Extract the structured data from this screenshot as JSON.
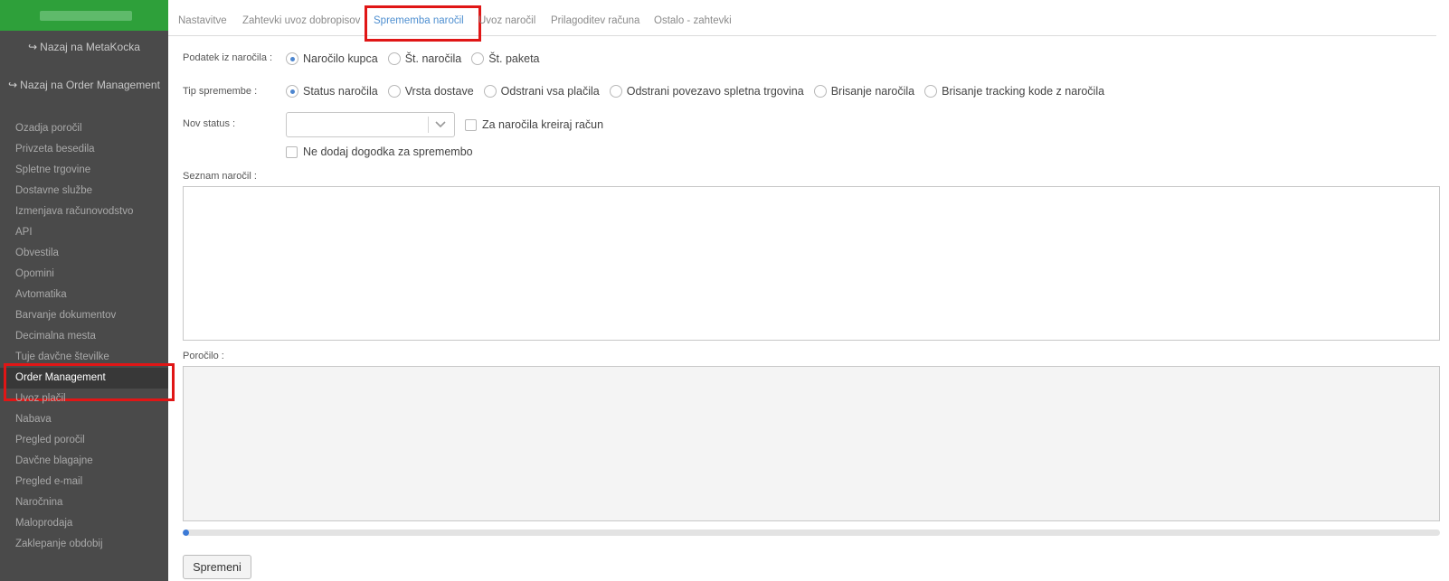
{
  "sidebar": {
    "back_metakocka": "Nazaj na MetaKocka",
    "back_order_management": "Nazaj na Order Management",
    "items": [
      {
        "label": "Ozadja poročil",
        "active": false
      },
      {
        "label": "Privzeta besedila",
        "active": false
      },
      {
        "label": "Spletne trgovine",
        "active": false
      },
      {
        "label": "Dostavne službe",
        "active": false
      },
      {
        "label": "Izmenjava računovodstvo",
        "active": false
      },
      {
        "label": "API",
        "active": false
      },
      {
        "label": "Obvestila",
        "active": false
      },
      {
        "label": "Opomini",
        "active": false
      },
      {
        "label": "Avtomatika",
        "active": false
      },
      {
        "label": "Barvanje dokumentov",
        "active": false
      },
      {
        "label": "Decimalna mesta",
        "active": false
      },
      {
        "label": "Tuje davčne številke",
        "active": false
      },
      {
        "label": "Order Management",
        "active": true
      },
      {
        "label": "Uvoz plačil",
        "active": false
      },
      {
        "label": "Nabava",
        "active": false
      },
      {
        "label": "Pregled poročil",
        "active": false
      },
      {
        "label": "Davčne blagajne",
        "active": false
      },
      {
        "label": "Pregled e-mail",
        "active": false
      },
      {
        "label": "Naročnina",
        "active": false
      },
      {
        "label": "Maloprodaja",
        "active": false
      },
      {
        "label": "Zaklepanje obdobij",
        "active": false
      }
    ]
  },
  "tabs": [
    {
      "label": "Nastavitve",
      "active": false
    },
    {
      "label": "Zahtevki uvoz dobropisov",
      "active": false
    },
    {
      "label": "Sprememba naročil",
      "active": true
    },
    {
      "label": "Uvoz naročil",
      "active": false
    },
    {
      "label": "Prilagoditev računa",
      "active": false
    },
    {
      "label": "Ostalo - zahtevki",
      "active": false
    }
  ],
  "form": {
    "source_label": "Podatek iz naročila :",
    "source_options": [
      {
        "label": "Naročilo kupca",
        "checked": true
      },
      {
        "label": "Št. naročila",
        "checked": false
      },
      {
        "label": "Št. paketa",
        "checked": false
      }
    ],
    "change_type_label": "Tip spremembe :",
    "change_type_options": [
      {
        "label": "Status naročila",
        "checked": true
      },
      {
        "label": "Vrsta dostave",
        "checked": false
      },
      {
        "label": "Odstrani vsa plačila",
        "checked": false
      },
      {
        "label": "Odstrani povezavo spletna trgovina",
        "checked": false
      },
      {
        "label": "Brisanje naročila",
        "checked": false
      },
      {
        "label": "Brisanje tracking kode z naročila",
        "checked": false
      }
    ],
    "new_status_label": "Nov status :",
    "new_status_value": "",
    "create_invoice_label": "Za naročila kreiraj račun",
    "no_event_label": "Ne dodaj dogodka za spremembo",
    "order_list_label": "Seznam naročil :",
    "order_list_value": "",
    "report_label": "Poročilo :",
    "report_value": "",
    "progress": 0.005,
    "submit_label": "Spremeni"
  },
  "colors": {
    "sidebar_bg": "#4a4a4a",
    "sidebar_top": "#2ea03a",
    "accent": "#4f8fd0",
    "highlight": "#e01616"
  }
}
